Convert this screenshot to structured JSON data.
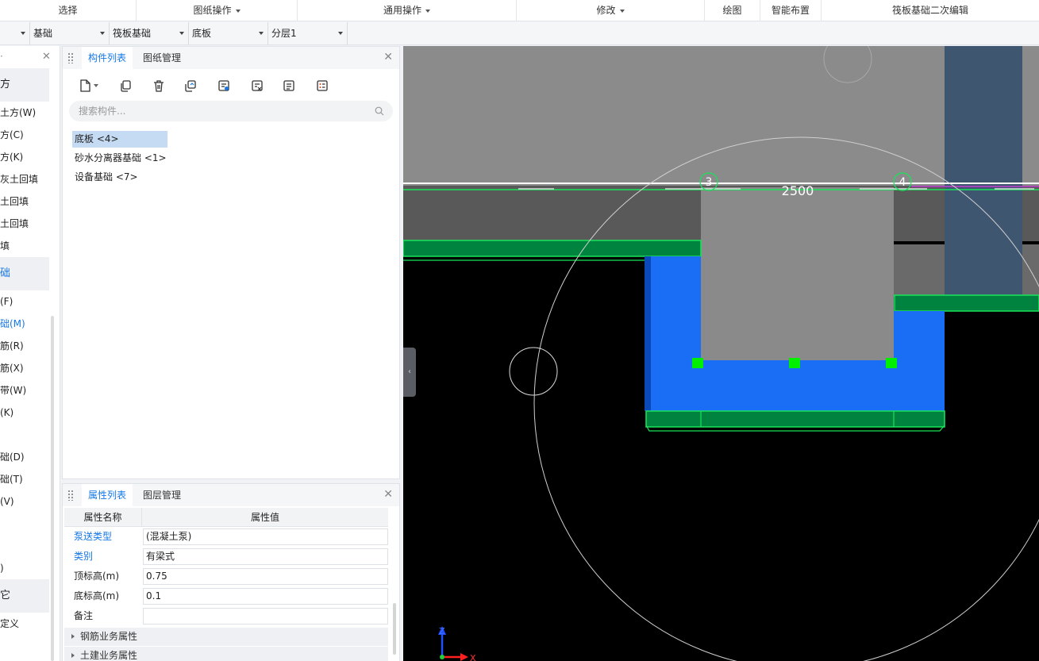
{
  "ribbon": {
    "groups": [
      {
        "label": "选择",
        "dropdown": false
      },
      {
        "label": "图纸操作",
        "dropdown": true
      },
      {
        "label": "通用操作",
        "dropdown": true
      },
      {
        "label": "修改",
        "dropdown": true
      },
      {
        "label": "绘图",
        "dropdown": false
      },
      {
        "label": "智能布置",
        "dropdown": false
      },
      {
        "label": "筏板基础二次编辑",
        "dropdown": false
      }
    ]
  },
  "selectors": [
    {
      "value": "",
      "dropdown": true
    },
    {
      "value": "基础",
      "dropdown": true
    },
    {
      "value": "筏板基础",
      "dropdown": true
    },
    {
      "value": "底板",
      "dropdown": true
    },
    {
      "value": "分层1",
      "dropdown": true
    }
  ],
  "leftnav": {
    "dot": "·",
    "close": "✕",
    "items": [
      {
        "label": "方",
        "kind": "category"
      },
      {
        "label": "土方(W)",
        "kind": "item"
      },
      {
        "label": "方(C)",
        "kind": "item"
      },
      {
        "label": "方(K)",
        "kind": "item"
      },
      {
        "label": "灰土回填",
        "kind": "item"
      },
      {
        "label": "土回填",
        "kind": "item"
      },
      {
        "label": "土回填",
        "kind": "item"
      },
      {
        "label": "填",
        "kind": "item"
      },
      {
        "label": "础",
        "kind": "category-active"
      },
      {
        "label": "(F)",
        "kind": "item"
      },
      {
        "label": "础(M)",
        "kind": "item-active"
      },
      {
        "label": "筋(R)",
        "kind": "item"
      },
      {
        "label": "筋(X)",
        "kind": "item"
      },
      {
        "label": "带(W)",
        "kind": "item"
      },
      {
        "label": "(K)",
        "kind": "item"
      },
      {
        "label": "",
        "kind": "item"
      },
      {
        "label": "础(D)",
        "kind": "item"
      },
      {
        "label": "础(T)",
        "kind": "item"
      },
      {
        "label": "(V)",
        "kind": "item"
      },
      {
        "label": "",
        "kind": "item"
      },
      {
        "label": "",
        "kind": "item"
      },
      {
        "label": ")",
        "kind": "item"
      },
      {
        "label": "它",
        "kind": "category"
      },
      {
        "label": "定义",
        "kind": "item"
      }
    ]
  },
  "component_panel": {
    "tabs": [
      {
        "label": "构件列表",
        "active": true
      },
      {
        "label": "图纸管理",
        "active": false
      }
    ],
    "close": "✕",
    "toolbar_icons": [
      "new-component-icon",
      "copy-icon",
      "delete-icon",
      "layer-copy-icon",
      "import-icon",
      "export-icon",
      "filter-icon",
      "list-icon"
    ],
    "search_placeholder": "搜索构件...",
    "components": [
      {
        "label": "底板 <4>",
        "selected": true
      },
      {
        "label": "砂水分离器基础 <1>",
        "selected": false
      },
      {
        "label": "设备基础 <7>",
        "selected": false
      }
    ]
  },
  "property_panel": {
    "tabs": [
      {
        "label": "属性列表",
        "active": true
      },
      {
        "label": "图层管理",
        "active": false
      }
    ],
    "close": "✕",
    "header": {
      "name": "属性名称",
      "value": "属性值"
    },
    "rows": [
      {
        "name": "泵送类型",
        "value": "(混凝土泵)",
        "link": true
      },
      {
        "name": "类别",
        "value": "有梁式",
        "link": true
      },
      {
        "name": "顶标高(m)",
        "value": "0.75",
        "link": false
      },
      {
        "name": "底标高(m)",
        "value": "0.1",
        "link": false
      },
      {
        "name": "备注",
        "value": "",
        "link": false
      }
    ],
    "groups": [
      "钢筋业务属性",
      "土建业务属性"
    ]
  },
  "viewport": {
    "axis_labels": [
      "3",
      "4"
    ],
    "dimension": "2500",
    "axes": {
      "x": "X",
      "z": "Z"
    },
    "colors": {
      "slab_blue": "#1a6ef5",
      "beam_green": "#00833f",
      "outline_green": "#18e45a",
      "column_slate": "#3e5670",
      "grey_block": "#8a8a8a"
    }
  }
}
